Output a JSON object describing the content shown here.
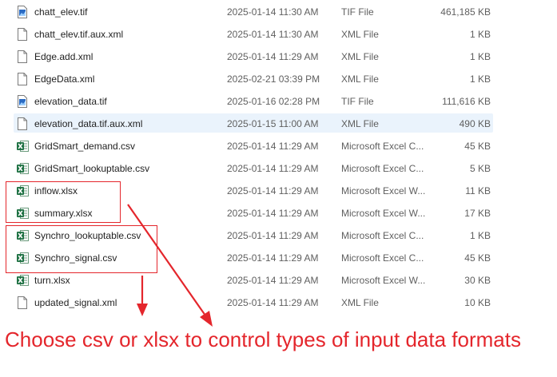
{
  "files": [
    {
      "name": "chatt_elev.tif",
      "date": "2025-01-14 11:30 AM",
      "type": "TIF File",
      "size": "461,185 KB",
      "icon": "tif-image-icon"
    },
    {
      "name": "chatt_elev.tif.aux.xml",
      "date": "2025-01-14 11:30 AM",
      "type": "XML File",
      "size": "1 KB",
      "icon": "blank-document-icon"
    },
    {
      "name": "Edge.add.xml",
      "date": "2025-01-14 11:29 AM",
      "type": "XML File",
      "size": "1 KB",
      "icon": "blank-document-icon"
    },
    {
      "name": "EdgeData.xml",
      "date": "2025-02-21 03:39 PM",
      "type": "XML File",
      "size": "1 KB",
      "icon": "blank-document-icon"
    },
    {
      "name": "elevation_data.tif",
      "date": "2025-01-16 02:28 PM",
      "type": "TIF File",
      "size": "111,616 KB",
      "icon": "tif-image-icon"
    },
    {
      "name": "elevation_data.tif.aux.xml",
      "date": "2025-01-15 11:00 AM",
      "type": "XML File",
      "size": "490 KB",
      "icon": "blank-document-icon"
    },
    {
      "name": "GridSmart_demand.csv",
      "date": "2025-01-14 11:29 AM",
      "type": "Microsoft Excel C...",
      "size": "45 KB",
      "icon": "excel-icon"
    },
    {
      "name": "GridSmart_lookuptable.csv",
      "date": "2025-01-14 11:29 AM",
      "type": "Microsoft Excel C...",
      "size": "5 KB",
      "icon": "excel-icon"
    },
    {
      "name": "inflow.xlsx",
      "date": "2025-01-14 11:29 AM",
      "type": "Microsoft Excel W...",
      "size": "11 KB",
      "icon": "excel-icon"
    },
    {
      "name": "summary.xlsx",
      "date": "2025-01-14 11:29 AM",
      "type": "Microsoft Excel W...",
      "size": "17 KB",
      "icon": "excel-icon"
    },
    {
      "name": "Synchro_lookuptable.csv",
      "date": "2025-01-14 11:29 AM",
      "type": "Microsoft Excel C...",
      "size": "1 KB",
      "icon": "excel-icon"
    },
    {
      "name": "Synchro_signal.csv",
      "date": "2025-01-14 11:29 AM",
      "type": "Microsoft Excel C...",
      "size": "45 KB",
      "icon": "excel-icon"
    },
    {
      "name": "turn.xlsx",
      "date": "2025-01-14 11:29 AM",
      "type": "Microsoft Excel W...",
      "size": "30 KB",
      "icon": "excel-icon"
    },
    {
      "name": "updated_signal.xml",
      "date": "2025-01-14 11:29 AM",
      "type": "XML File",
      "size": "10 KB",
      "icon": "blank-document-icon"
    }
  ],
  "selected_file": "elevation_data.tif.aux.xml",
  "annotation": {
    "caption": "Choose csv or xlsx to control types of input data formats",
    "color": "#e4262c"
  },
  "colors": {
    "selection": "#eaf3fc",
    "excel_green": "#1f7244",
    "tif_blue": "#2b6cc4"
  }
}
